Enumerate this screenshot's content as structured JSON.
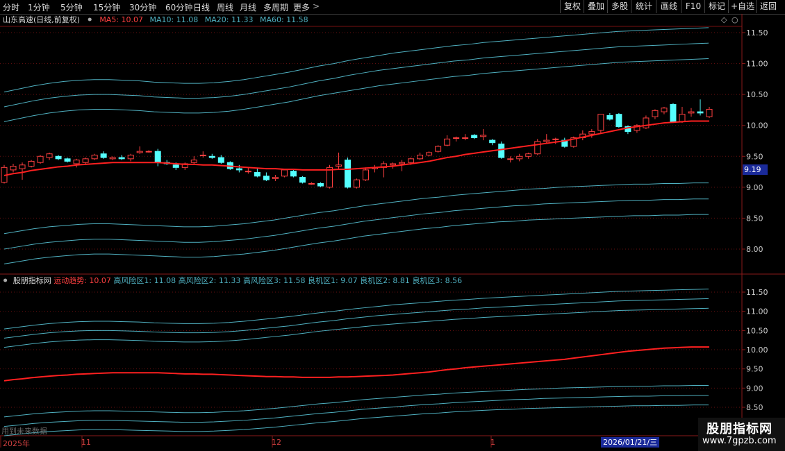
{
  "toolbar": {
    "periods": [
      "分时",
      "1分钟",
      "5分钟",
      "15分钟",
      "30分钟",
      "60分钟",
      "日线",
      "周线",
      "月线",
      "多周期",
      "更多"
    ],
    "active_period": "日线",
    "right_buttons": [
      "复权",
      "叠加",
      "多股",
      "统计",
      "画线",
      "F10",
      "标记",
      "+自选",
      "返回"
    ]
  },
  "main_chart": {
    "title": "山东高速(日线,前复权)",
    "ma_labels": [
      {
        "text": "MA5: 10.07",
        "color": "#ff4040"
      },
      {
        "text": "MA10: 11.08",
        "color": "#4fb0c0"
      },
      {
        "text": "MA20: 11.33",
        "color": "#4fb0c0"
      },
      {
        "text": "MA60: 11.58",
        "color": "#4fb0c0"
      }
    ],
    "axis_ticks": [
      "11.50",
      "11.00",
      "10.50",
      "10.00",
      "9.50",
      "9.00",
      "8.50",
      "8.00"
    ],
    "current_price_tag": "9.19"
  },
  "indicator_chart": {
    "name": "股朋指标网",
    "labels": [
      {
        "text": "运动趋势: 10.07",
        "color": "#ff4040"
      },
      {
        "text": "高风险区1: 11.08",
        "color": "#4fb0c0"
      },
      {
        "text": "高风险区2: 11.33",
        "color": "#4fb0c0"
      },
      {
        "text": "高风险区3: 11.58",
        "color": "#4fb0c0"
      },
      {
        "text": "良机区1: 9.07",
        "color": "#4fb0c0"
      },
      {
        "text": "良机区2: 8.81",
        "color": "#4fb0c0"
      },
      {
        "text": "良机区3: 8.56",
        "color": "#4fb0c0"
      }
    ],
    "axis_ticks": [
      "11.50",
      "11.00",
      "10.50",
      "10.00",
      "9.50",
      "9.00",
      "8.50"
    ],
    "note": "用到未来数据"
  },
  "date_axis": {
    "labels": [
      "2025年",
      "11",
      "12",
      "1"
    ],
    "cursor_date": "2026/01/21/三"
  },
  "brand": {
    "name": "股朋指标网",
    "url": "www.7gpzb.com"
  },
  "colors": {
    "up": "#ff4040",
    "down": "#54ffff",
    "trend": "#ff2020",
    "bands": "#4fb0c0",
    "grid": "#7a1010"
  },
  "chart_data": {
    "type": "candlestick",
    "title": "山东高速(日线,前复权)",
    "ylim": [
      7.6,
      11.8
    ],
    "candles": [
      {
        "o": 9.08,
        "h": 9.36,
        "l": 9.06,
        "c": 9.32
      },
      {
        "o": 9.28,
        "h": 9.38,
        "l": 9.24,
        "c": 9.34
      },
      {
        "o": 9.3,
        "h": 9.4,
        "l": 9.12,
        "c": 9.36
      },
      {
        "o": 9.34,
        "h": 9.44,
        "l": 9.32,
        "c": 9.42
      },
      {
        "o": 9.4,
        "h": 9.52,
        "l": 9.38,
        "c": 9.5
      },
      {
        "o": 9.48,
        "h": 9.56,
        "l": 9.44,
        "c": 9.54
      },
      {
        "o": 9.5,
        "h": 9.52,
        "l": 9.44,
        "c": 9.46
      },
      {
        "o": 9.46,
        "h": 9.48,
        "l": 9.4,
        "c": 9.42
      },
      {
        "o": 9.38,
        "h": 9.46,
        "l": 9.32,
        "c": 9.44
      },
      {
        "o": 9.4,
        "h": 9.48,
        "l": 9.36,
        "c": 9.46
      },
      {
        "o": 9.46,
        "h": 9.54,
        "l": 9.44,
        "c": 9.52
      },
      {
        "o": 9.54,
        "h": 9.58,
        "l": 9.46,
        "c": 9.48
      },
      {
        "o": 9.46,
        "h": 9.5,
        "l": 9.44,
        "c": 9.48
      },
      {
        "o": 9.48,
        "h": 9.52,
        "l": 9.44,
        "c": 9.46
      },
      {
        "o": 9.46,
        "h": 9.54,
        "l": 9.42,
        "c": 9.52
      },
      {
        "o": 9.56,
        "h": 9.66,
        "l": 9.54,
        "c": 9.58
      },
      {
        "o": 9.58,
        "h": 9.6,
        "l": 9.56,
        "c": 9.58
      },
      {
        "o": 9.58,
        "h": 9.62,
        "l": 9.34,
        "c": 9.4
      },
      {
        "o": 9.4,
        "h": 9.44,
        "l": 9.36,
        "c": 9.38
      },
      {
        "o": 9.36,
        "h": 9.4,
        "l": 9.28,
        "c": 9.32
      },
      {
        "o": 9.32,
        "h": 9.4,
        "l": 9.28,
        "c": 9.38
      },
      {
        "o": 9.4,
        "h": 9.5,
        "l": 9.38,
        "c": 9.44
      },
      {
        "o": 9.52,
        "h": 9.58,
        "l": 9.48,
        "c": 9.52
      },
      {
        "o": 9.5,
        "h": 9.54,
        "l": 9.46,
        "c": 9.48
      },
      {
        "o": 9.48,
        "h": 9.52,
        "l": 9.38,
        "c": 9.4
      },
      {
        "o": 9.4,
        "h": 9.42,
        "l": 9.28,
        "c": 9.3
      },
      {
        "o": 9.3,
        "h": 9.36,
        "l": 9.24,
        "c": 9.28
      },
      {
        "o": 9.26,
        "h": 9.32,
        "l": 9.22,
        "c": 9.26
      },
      {
        "o": 9.24,
        "h": 9.3,
        "l": 9.16,
        "c": 9.18
      },
      {
        "o": 9.18,
        "h": 9.24,
        "l": 9.1,
        "c": 9.12
      },
      {
        "o": 9.14,
        "h": 9.2,
        "l": 9.1,
        "c": 9.16
      },
      {
        "o": 9.18,
        "h": 9.3,
        "l": 9.16,
        "c": 9.28
      },
      {
        "o": 9.26,
        "h": 9.28,
        "l": 9.16,
        "c": 9.18
      },
      {
        "o": 9.16,
        "h": 9.18,
        "l": 9.06,
        "c": 9.08
      },
      {
        "o": 9.06,
        "h": 9.08,
        "l": 9.04,
        "c": 9.06
      },
      {
        "o": 9.06,
        "h": 9.08,
        "l": 9.0,
        "c": 9.02
      },
      {
        "o": 9.0,
        "h": 9.36,
        "l": 8.98,
        "c": 9.32
      },
      {
        "o": 9.34,
        "h": 9.56,
        "l": 9.3,
        "c": 9.36
      },
      {
        "o": 9.44,
        "h": 9.48,
        "l": 8.98,
        "c": 9.0
      },
      {
        "o": 9.0,
        "h": 9.14,
        "l": 8.98,
        "c": 9.12
      },
      {
        "o": 9.12,
        "h": 9.32,
        "l": 9.1,
        "c": 9.28
      },
      {
        "o": 9.3,
        "h": 9.36,
        "l": 9.24,
        "c": 9.32
      },
      {
        "o": 9.32,
        "h": 9.42,
        "l": 9.16,
        "c": 9.38
      },
      {
        "o": 9.36,
        "h": 9.4,
        "l": 9.3,
        "c": 9.38
      },
      {
        "o": 9.38,
        "h": 9.44,
        "l": 9.26,
        "c": 9.4
      },
      {
        "o": 9.4,
        "h": 9.48,
        "l": 9.36,
        "c": 9.46
      },
      {
        "o": 9.46,
        "h": 9.56,
        "l": 9.44,
        "c": 9.52
      },
      {
        "o": 9.52,
        "h": 9.58,
        "l": 9.5,
        "c": 9.56
      },
      {
        "o": 9.58,
        "h": 9.68,
        "l": 9.56,
        "c": 9.66
      },
      {
        "o": 9.68,
        "h": 9.84,
        "l": 9.66,
        "c": 9.78
      },
      {
        "o": 9.8,
        "h": 9.82,
        "l": 9.74,
        "c": 9.8
      },
      {
        "o": 9.8,
        "h": 9.86,
        "l": 9.76,
        "c": 9.8
      },
      {
        "o": 9.84,
        "h": 9.86,
        "l": 9.78,
        "c": 9.8
      },
      {
        "o": 9.82,
        "h": 9.94,
        "l": 9.76,
        "c": 9.84
      },
      {
        "o": 9.76,
        "h": 9.78,
        "l": 9.68,
        "c": 9.72
      },
      {
        "o": 9.7,
        "h": 9.74,
        "l": 9.46,
        "c": 9.48
      },
      {
        "o": 9.46,
        "h": 9.5,
        "l": 9.4,
        "c": 9.46
      },
      {
        "o": 9.46,
        "h": 9.54,
        "l": 9.42,
        "c": 9.5
      },
      {
        "o": 9.5,
        "h": 9.56,
        "l": 9.46,
        "c": 9.54
      },
      {
        "o": 9.54,
        "h": 9.78,
        "l": 9.52,
        "c": 9.74
      },
      {
        "o": 9.74,
        "h": 9.86,
        "l": 9.7,
        "c": 9.76
      },
      {
        "o": 9.78,
        "h": 9.8,
        "l": 9.7,
        "c": 9.78
      },
      {
        "o": 9.76,
        "h": 9.8,
        "l": 9.64,
        "c": 9.66
      },
      {
        "o": 9.66,
        "h": 9.82,
        "l": 9.64,
        "c": 9.8
      },
      {
        "o": 9.8,
        "h": 9.92,
        "l": 9.76,
        "c": 9.86
      },
      {
        "o": 9.86,
        "h": 9.94,
        "l": 9.8,
        "c": 9.9
      },
      {
        "o": 9.92,
        "h": 10.18,
        "l": 9.88,
        "c": 10.18
      },
      {
        "o": 10.16,
        "h": 10.2,
        "l": 10.08,
        "c": 10.1
      },
      {
        "o": 10.18,
        "h": 10.2,
        "l": 9.96,
        "c": 9.98
      },
      {
        "o": 9.98,
        "h": 10.0,
        "l": 9.86,
        "c": 9.9
      },
      {
        "o": 9.92,
        "h": 10.02,
        "l": 9.88,
        "c": 10.0
      },
      {
        "o": 9.96,
        "h": 10.16,
        "l": 9.94,
        "c": 10.12
      },
      {
        "o": 10.14,
        "h": 10.26,
        "l": 10.1,
        "c": 10.24
      },
      {
        "o": 10.22,
        "h": 10.3,
        "l": 10.18,
        "c": 10.28
      },
      {
        "o": 10.34,
        "h": 10.36,
        "l": 10.04,
        "c": 10.06
      },
      {
        "o": 10.06,
        "h": 10.3,
        "l": 10.04,
        "c": 10.18
      },
      {
        "o": 10.2,
        "h": 10.28,
        "l": 10.14,
        "c": 10.22
      },
      {
        "o": 10.22,
        "h": 10.42,
        "l": 10.16,
        "c": 10.2
      },
      {
        "o": 10.14,
        "h": 10.3,
        "l": 10.12,
        "c": 10.26
      }
    ],
    "trend": [
      9.19,
      9.22,
      9.24,
      9.27,
      9.29,
      9.31,
      9.33,
      9.34,
      9.36,
      9.37,
      9.38,
      9.39,
      9.4,
      9.4,
      9.4,
      9.4,
      9.4,
      9.4,
      9.39,
      9.38,
      9.37,
      9.37,
      9.36,
      9.36,
      9.35,
      9.34,
      9.33,
      9.32,
      9.31,
      9.3,
      9.3,
      9.29,
      9.29,
      9.28,
      9.28,
      9.28,
      9.28,
      9.29,
      9.29,
      9.3,
      9.31,
      9.32,
      9.33,
      9.34,
      9.36,
      9.38,
      9.4,
      9.42,
      9.45,
      9.48,
      9.5,
      9.53,
      9.55,
      9.57,
      9.59,
      9.61,
      9.63,
      9.65,
      9.67,
      9.69,
      9.71,
      9.73,
      9.75,
      9.78,
      9.81,
      9.84,
      9.87,
      9.9,
      9.93,
      9.96,
      9.98,
      10.0,
      10.02,
      10.04,
      10.05,
      10.06,
      10.07,
      10.07,
      10.07
    ],
    "high_risk_1": [
      10.06,
      10.11,
      10.16,
      10.2,
      10.23,
      10.25,
      10.26,
      10.26,
      10.25,
      10.24,
      10.22,
      10.21,
      10.2,
      10.2,
      10.21,
      10.23,
      10.26,
      10.3,
      10.34,
      10.38,
      10.43,
      10.48,
      10.52,
      10.56,
      10.6,
      10.64,
      10.67,
      10.7,
      10.73,
      10.76,
      10.79,
      10.81,
      10.84,
      10.86,
      10.88,
      10.9,
      10.92,
      10.94,
      10.96,
      10.98,
      11.0,
      11.02,
      11.03,
      11.04,
      11.05,
      11.06,
      11.07,
      11.08
    ],
    "high_risk_2": [
      10.3,
      10.35,
      10.4,
      10.44,
      10.47,
      10.49,
      10.5,
      10.5,
      10.49,
      10.48,
      10.46,
      10.45,
      10.44,
      10.44,
      10.45,
      10.47,
      10.5,
      10.54,
      10.58,
      10.62,
      10.67,
      10.72,
      10.76,
      10.81,
      10.85,
      10.89,
      10.92,
      10.95,
      10.98,
      11.01,
      11.04,
      11.06,
      11.09,
      11.11,
      11.13,
      11.15,
      11.17,
      11.19,
      11.21,
      11.23,
      11.25,
      11.27,
      11.28,
      11.29,
      11.3,
      11.31,
      11.32,
      11.33
    ],
    "high_risk_3": [
      10.54,
      10.59,
      10.64,
      10.68,
      10.71,
      10.73,
      10.74,
      10.74,
      10.73,
      10.72,
      10.7,
      10.69,
      10.68,
      10.68,
      10.69,
      10.71,
      10.74,
      10.78,
      10.82,
      10.86,
      10.91,
      10.96,
      11.0,
      11.05,
      11.09,
      11.13,
      11.17,
      11.2,
      11.23,
      11.26,
      11.29,
      11.31,
      11.34,
      11.36,
      11.38,
      11.4,
      11.42,
      11.44,
      11.46,
      11.48,
      11.5,
      11.52,
      11.53,
      11.54,
      11.55,
      11.56,
      11.57,
      11.58
    ],
    "opportunity_1": [
      8.25,
      8.29,
      8.33,
      8.36,
      8.38,
      8.4,
      8.41,
      8.41,
      8.4,
      8.39,
      8.38,
      8.37,
      8.36,
      8.36,
      8.37,
      8.39,
      8.41,
      8.44,
      8.47,
      8.51,
      8.55,
      8.59,
      8.62,
      8.66,
      8.7,
      8.73,
      8.76,
      8.79,
      8.82,
      8.84,
      8.87,
      8.89,
      8.91,
      8.93,
      8.95,
      8.97,
      8.98,
      9.0,
      9.01,
      9.02,
      9.03,
      9.04,
      9.05,
      9.05,
      9.06,
      9.06,
      9.07,
      9.07
    ],
    "opportunity_2": [
      8.0,
      8.04,
      8.08,
      8.11,
      8.13,
      8.15,
      8.16,
      8.16,
      8.15,
      8.14,
      8.13,
      8.12,
      8.11,
      8.11,
      8.12,
      8.14,
      8.16,
      8.19,
      8.22,
      8.26,
      8.3,
      8.34,
      8.37,
      8.41,
      8.45,
      8.48,
      8.51,
      8.54,
      8.57,
      8.59,
      8.62,
      8.64,
      8.66,
      8.68,
      8.7,
      8.71,
      8.73,
      8.74,
      8.75,
      8.76,
      8.77,
      8.78,
      8.79,
      8.79,
      8.8,
      8.8,
      8.81,
      8.81
    ],
    "opportunity_3": [
      7.76,
      7.8,
      7.84,
      7.87,
      7.89,
      7.91,
      7.92,
      7.92,
      7.91,
      7.9,
      7.89,
      7.88,
      7.87,
      7.87,
      7.88,
      7.9,
      7.92,
      7.95,
      7.98,
      8.02,
      8.06,
      8.1,
      8.13,
      8.17,
      8.21,
      8.24,
      8.27,
      8.3,
      8.33,
      8.35,
      8.38,
      8.4,
      8.42,
      8.44,
      8.45,
      8.47,
      8.48,
      8.49,
      8.5,
      8.51,
      8.52,
      8.53,
      8.54,
      8.54,
      8.55,
      8.55,
      8.56,
      8.56
    ]
  }
}
